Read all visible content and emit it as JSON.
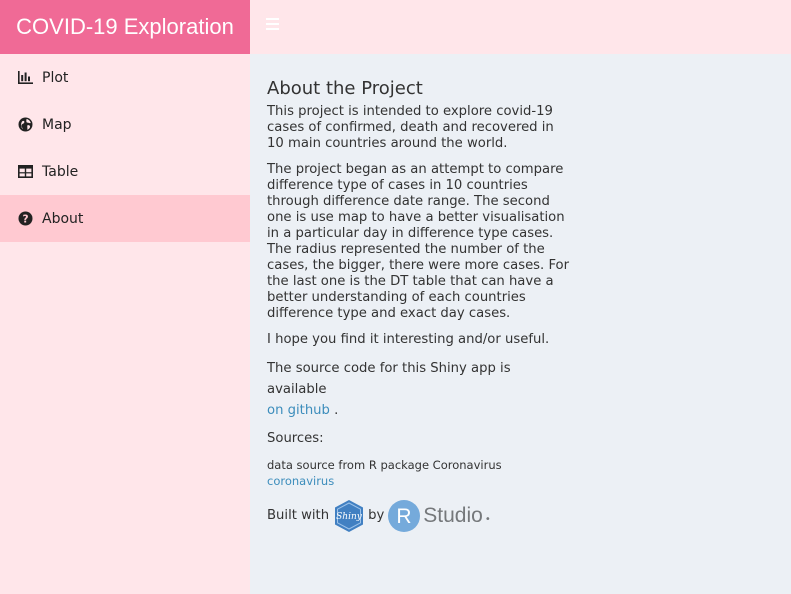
{
  "header": {
    "title": "COVID-19 Exploration"
  },
  "sidebar": {
    "items": [
      {
        "label": "Plot",
        "icon": "bar-chart-icon"
      },
      {
        "label": "Map",
        "icon": "globe-icon"
      },
      {
        "label": "Table",
        "icon": "table-icon"
      },
      {
        "label": "About",
        "icon": "question-circle-icon",
        "active": true
      }
    ]
  },
  "about": {
    "title": "About the Project",
    "p1": "This project is intended to explore covid-19 cases of confirmed, death and recovered in 10 main countries around the world.",
    "p2": "The project began as an attempt to compare difference type of cases in 10 countries through difference date range. The second one is use map to have a better visualisation in a particular day in difference type cases. The radius represented the number of the cases, the bigger, there were more cases. For the last one is the DT table that can have a better understanding of each countries difference type and exact day cases.",
    "p3": "I hope you find it interesting and/or useful.",
    "p4_prefix": "The source code for this Shiny app is available",
    "p4_link": "on github",
    "p4_suffix": ".",
    "sources_label": "Sources:",
    "data_source_text": "data source from R package Coronavirus",
    "data_source_link": "coronavirus",
    "built_with": "Built with",
    "shiny_logo": "Shiny",
    "by": "by",
    "rstudio_r": "R",
    "rstudio_text": "Studio"
  },
  "colors": {
    "brand": "#f06a96",
    "header_bg": "#ffe6ea",
    "sidebar_bg": "#ffe6ea",
    "sidebar_active": "#ffc9d1",
    "content_bg": "#ecf0f5",
    "link": "#3c8dbc"
  }
}
